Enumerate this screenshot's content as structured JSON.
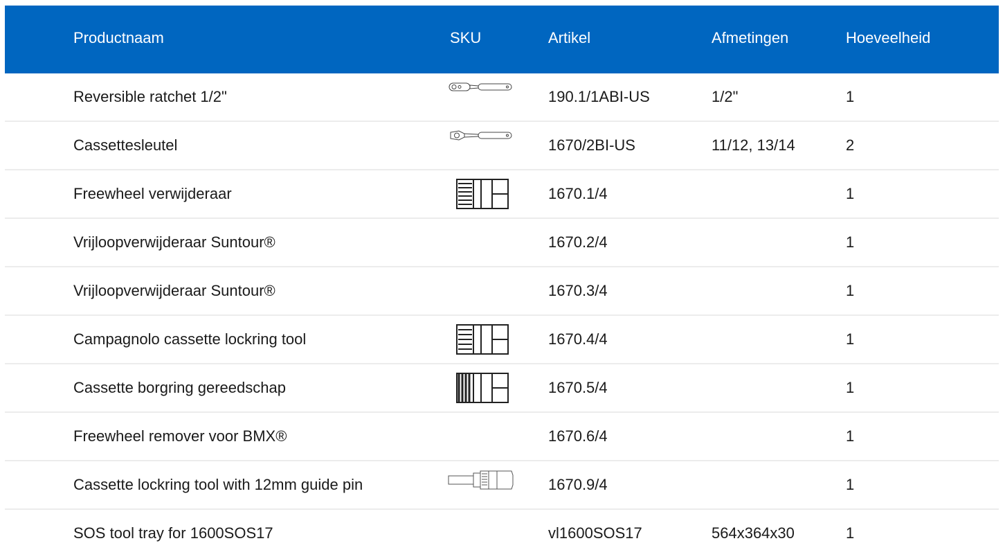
{
  "header": {
    "productnaam": "Productnaam",
    "sku": "SKU",
    "artikel": "Artikel",
    "afmetingen": "Afmetingen",
    "hoeveelheid": "Hoeveelheid"
  },
  "rows": [
    {
      "name": "Reversible ratchet 1/2\"",
      "sku_icon": "ratchet-icon",
      "artikel": "190.1/1ABI-US",
      "afmetingen": "1/2\"",
      "qty": "1"
    },
    {
      "name": "Cassettesleutel",
      "sku_icon": "ratchet-icon",
      "artikel": "1670/2BI-US",
      "afmetingen": "11/12, 13/14",
      "qty": "2"
    },
    {
      "name": "Freewheel verwijderaar",
      "sku_icon": "socket-icon",
      "artikel": "1670.1/4",
      "afmetingen": "",
      "qty": "1"
    },
    {
      "name": "Vrijloopverwijderaar Suntour®",
      "sku_icon": "",
      "artikel": "1670.2/4",
      "afmetingen": "",
      "qty": "1"
    },
    {
      "name": "Vrijloopverwijderaar Suntour®",
      "sku_icon": "",
      "artikel": "1670.3/4",
      "afmetingen": "",
      "qty": "1"
    },
    {
      "name": "Campagnolo cassette lockring tool",
      "sku_icon": "socket-icon",
      "artikel": "1670.4/4",
      "afmetingen": "",
      "qty": "1"
    },
    {
      "name": "Cassette borgring gereedschap",
      "sku_icon": "socket-icon",
      "artikel": "1670.5/4",
      "afmetingen": "",
      "qty": "1"
    },
    {
      "name": "Freewheel remover voor BMX®",
      "sku_icon": "",
      "artikel": "1670.6/4",
      "afmetingen": "",
      "qty": "1"
    },
    {
      "name": "Cassette lockring tool with 12mm guide pin",
      "sku_icon": "guide-pin-tool-icon",
      "artikel": "1670.9/4",
      "afmetingen": "",
      "qty": "1"
    },
    {
      "name": "SOS tool tray for 1600SOS17",
      "sku_icon": "",
      "artikel": "vl1600SOS17",
      "afmetingen": "564x364x30",
      "qty": "1"
    }
  ],
  "colors": {
    "header_bg": "#0066c0",
    "header_text": "#ffffff",
    "row_divider": "#ececec"
  }
}
